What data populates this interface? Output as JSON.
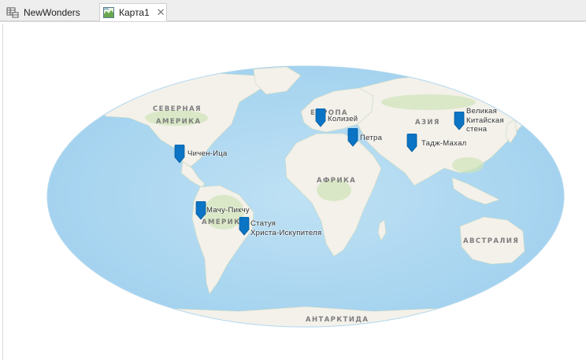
{
  "tabs": [
    {
      "label": "NewWonders",
      "icon": "table-icon",
      "active": false
    },
    {
      "label": "Карта1",
      "icon": "map-tab-icon",
      "active": true
    }
  ],
  "close_glyph": "✕",
  "map": {
    "regions": {
      "north_america_1": "СЕВЕРНАЯ",
      "north_america_2": "АМЕРИКА",
      "south_america": "АМЕРИКА",
      "europe": "ЕВРОПА",
      "asia": "АЗИЯ",
      "africa": "АФРИКА",
      "australia": "АВСТРАЛИЯ",
      "antarctica": "АНТАРКТИДА"
    },
    "wonders": [
      {
        "name": "Колизей"
      },
      {
        "name": "Петра"
      },
      {
        "name": "Великая Китайская стена",
        "lines": [
          "Великая",
          "Китайская",
          "стена"
        ]
      },
      {
        "name": "Тадж-Махал"
      },
      {
        "name": "Чичен-Ица"
      },
      {
        "name": "Мачу-Пикчу"
      },
      {
        "name": "Статуя Христа-Искупителя",
        "lines": [
          "Статуя",
          "Христа-Искупителя"
        ]
      }
    ],
    "pin_color": "#0b74c4"
  }
}
